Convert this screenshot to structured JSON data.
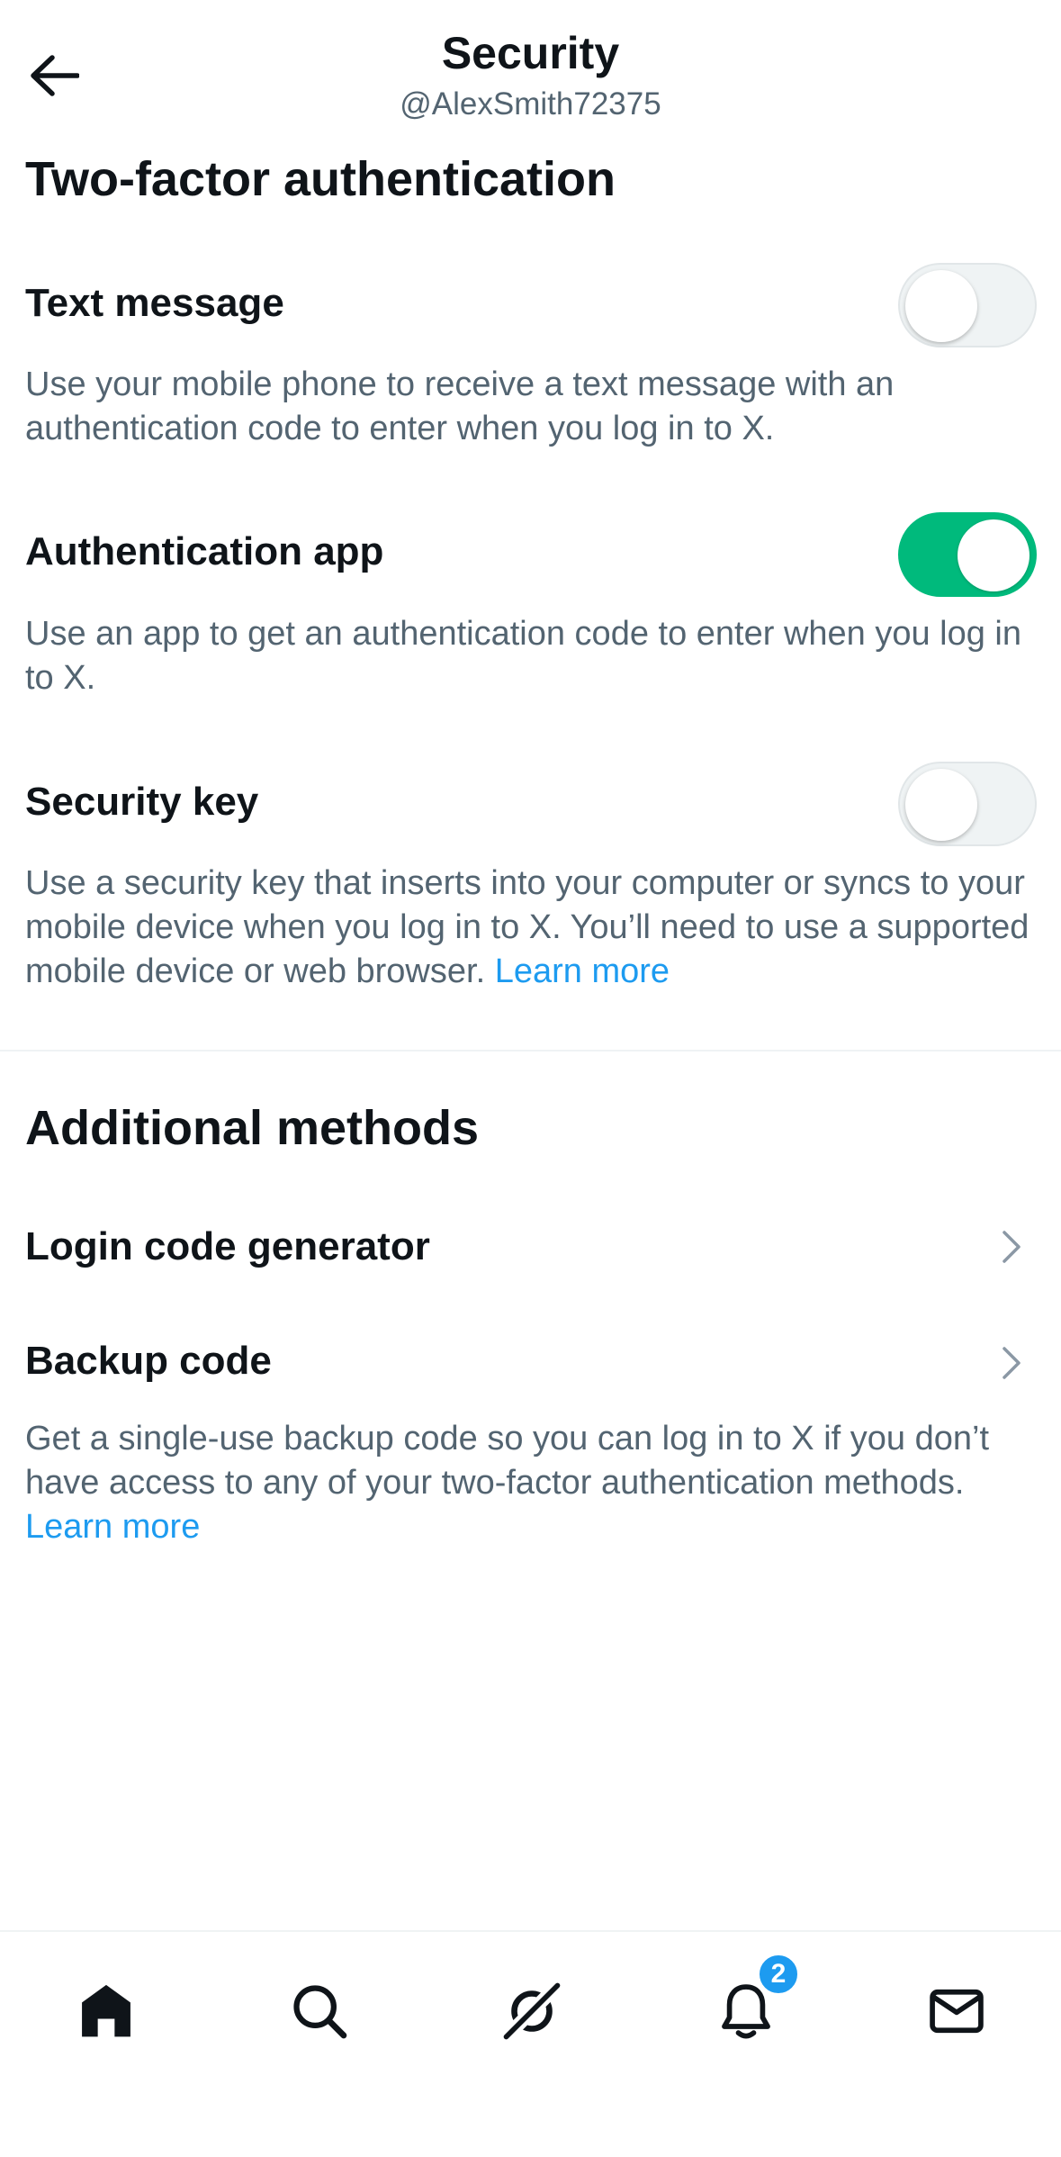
{
  "header": {
    "title": "Security",
    "username": "@AlexSmith72375"
  },
  "two_factor": {
    "title": "Two-factor authentication",
    "items": [
      {
        "label": "Text message",
        "enabled": false,
        "description": "Use your mobile phone to receive a text message with an authentication code to enter when you log in to X."
      },
      {
        "label": "Authentication app",
        "enabled": true,
        "description": "Use an app to get an authentication code to enter when you log in to X."
      },
      {
        "label": "Security key",
        "enabled": false,
        "description": "Use a security key that inserts into your computer or syncs to your mobile device when you log in to X. You’ll need to use a supported mobile device or web browser.",
        "link": "Learn more"
      }
    ]
  },
  "additional": {
    "title": "Additional methods",
    "items": [
      {
        "label": "Login code generator"
      },
      {
        "label": "Backup code",
        "description": "Get a single-use backup code so you can log in to X if you don’t have access to any of your two-factor authentication methods.",
        "link": "Learn more"
      }
    ]
  },
  "bottom_nav": {
    "items": [
      {
        "icon": "home-icon",
        "active": true
      },
      {
        "icon": "search-icon"
      },
      {
        "icon": "grok-icon"
      },
      {
        "icon": "bell-icon",
        "badge": "2"
      },
      {
        "icon": "mail-icon"
      }
    ]
  },
  "colors": {
    "accent": "#1d9bf0",
    "toggle_on": "#00ba7c",
    "text_primary": "#0f1419",
    "text_secondary": "#536471"
  }
}
